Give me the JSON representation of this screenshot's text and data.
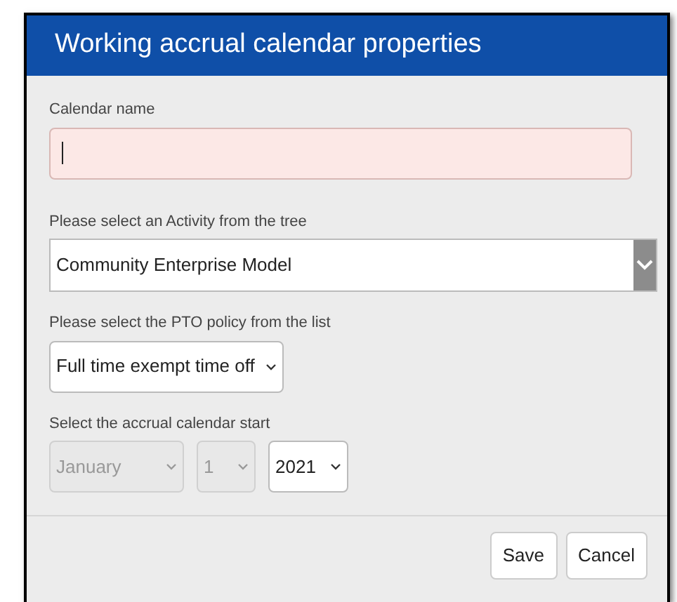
{
  "dialog": {
    "title": "Working accrual calendar properties",
    "calendar_name": {
      "label": "Calendar name",
      "invalid": true,
      "focused": true
    },
    "activity": {
      "label": "Please select an Activity from the tree",
      "value": "Community Enterprise Model"
    },
    "pto_policy": {
      "label": "Please select the PTO policy from the list",
      "value": "Full time exempt time off"
    },
    "start": {
      "label": "Select the accrual calendar start",
      "selects": [
        {
          "value": "January",
          "disabled": true
        },
        {
          "value": "1",
          "disabled": true
        },
        {
          "value": "2021",
          "disabled": false
        }
      ]
    },
    "buttons": [
      "Save",
      "Cancel"
    ]
  }
}
